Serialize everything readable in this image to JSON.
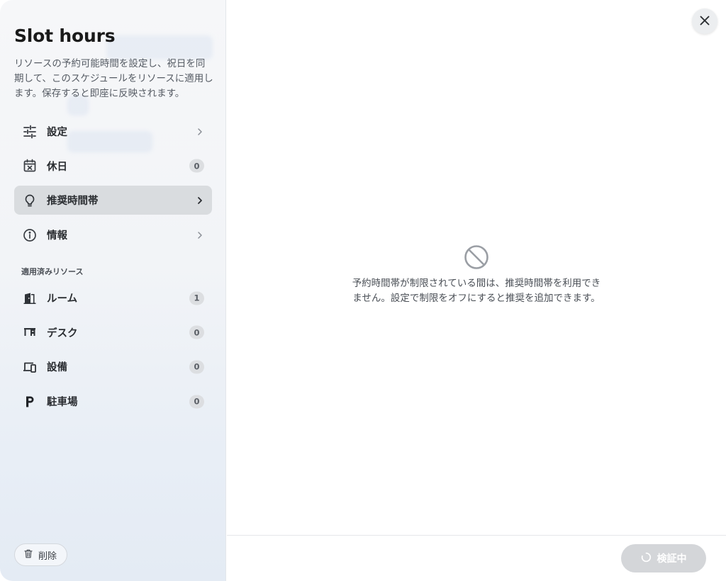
{
  "sidebar": {
    "title": "Slot hours",
    "description": "リソースの予約可能時間を設定し、祝日を同期して、このスケジュールをリソースに適用します。保存すると即座に反映されます。",
    "menu": [
      {
        "label": "設定",
        "icon": "sliders-icon",
        "trailing": "chevron"
      },
      {
        "label": "休日",
        "icon": "calendar-x-icon",
        "trailing": "badge",
        "count": "0"
      },
      {
        "label": "推奨時間帯",
        "icon": "lightbulb-icon",
        "trailing": "chevron",
        "active": true
      },
      {
        "label": "情報",
        "icon": "info-icon",
        "trailing": "chevron"
      }
    ],
    "resources_section_label": "適用済みリソース",
    "resources": [
      {
        "label": "ルーム",
        "icon": "room-door-icon",
        "count": "1"
      },
      {
        "label": "デスク",
        "icon": "desk-icon",
        "count": "0"
      },
      {
        "label": "設備",
        "icon": "devices-icon",
        "count": "0"
      },
      {
        "label": "駐車場",
        "icon": "parking-icon",
        "count": "0"
      }
    ],
    "delete_label": "削除"
  },
  "main": {
    "empty_state_icon": "prohibited-icon",
    "empty_state_text": "予約時間帯が制限されている間は、推奨時間帯を利用できません。設定で制限をオフにすると推奨を追加できます。",
    "verify_button_label": "検証中"
  },
  "colors": {
    "active_item_bg": "#d9dcdf",
    "badge_bg": "#dcdee1",
    "disabled_button_bg": "#d4d6d9"
  }
}
